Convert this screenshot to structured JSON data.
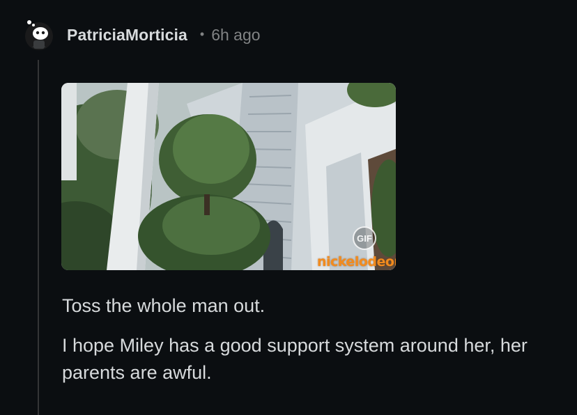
{
  "comment": {
    "author": "PatriciaMorticia",
    "separator": "•",
    "timestamp": "6h ago",
    "media": {
      "badge_label": "GIF",
      "watermark": "nickelodeon nite"
    },
    "paragraphs": [
      "Toss the whole man out.",
      "I hope Miley has a good support system around her, her parents are awful."
    ]
  },
  "colors": {
    "background": "#0b0e11",
    "text_primary": "#d7dadc",
    "text_secondary": "#818384",
    "thread_line": "#343536",
    "watermark_orange": "#f28b1e"
  },
  "icons": {
    "avatar": "snoo-avatar-icon",
    "badge": "gif-badge-icon"
  }
}
